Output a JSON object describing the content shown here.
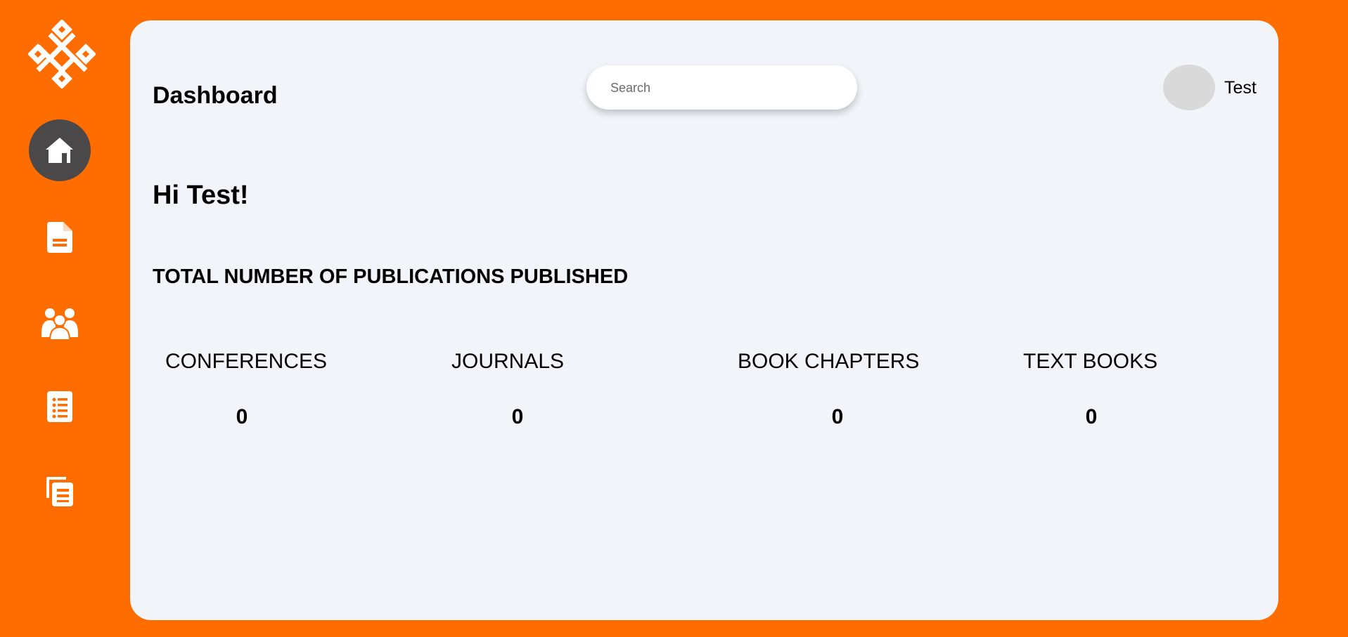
{
  "colors": {
    "background": "#ff6d00",
    "card": "#f1f5f9",
    "active_nav": "#4a4848",
    "avatar": "#d9d9d9"
  },
  "sidebar": {
    "logo_icon": "knot-logo-icon",
    "items": [
      {
        "icon": "home-icon",
        "active": true
      },
      {
        "icon": "document-icon",
        "active": false
      },
      {
        "icon": "users-group-icon",
        "active": false
      },
      {
        "icon": "list-document-icon",
        "active": false
      },
      {
        "icon": "books-copy-icon",
        "active": false
      }
    ]
  },
  "header": {
    "title": "Dashboard",
    "search_placeholder": "Search",
    "user_name": "Test"
  },
  "main": {
    "greeting": "Hi Test!",
    "section_title": "TOTAL NUMBER OF PUBLICATIONS PUBLISHED",
    "stats": [
      {
        "label": "CONFERENCES",
        "value": "0"
      },
      {
        "label": "JOURNALS",
        "value": "0"
      },
      {
        "label": "BOOK CHAPTERS",
        "value": "0"
      },
      {
        "label": "TEXT BOOKS",
        "value": "0"
      }
    ]
  }
}
